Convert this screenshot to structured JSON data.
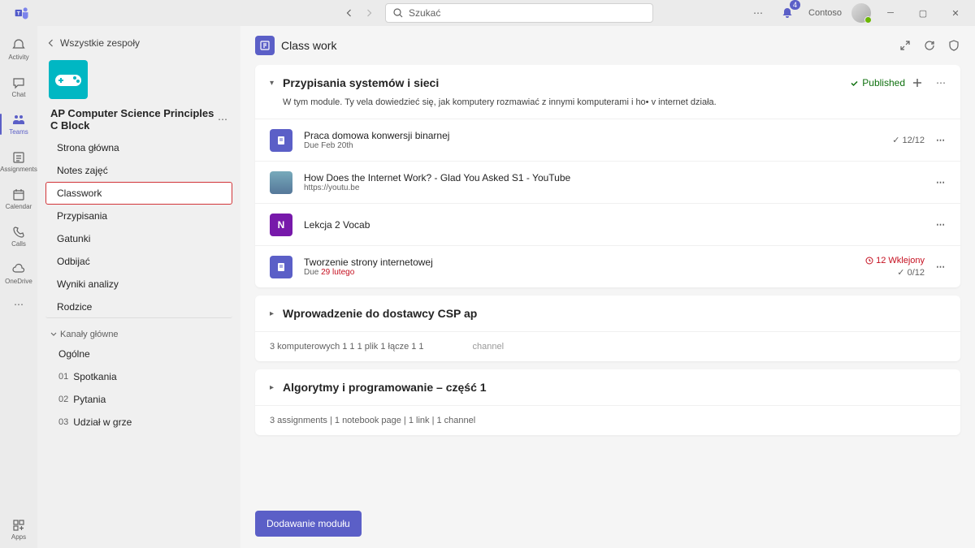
{
  "search": {
    "placeholder": "Szukać"
  },
  "header": {
    "org": "Contoso",
    "notification_count": "4"
  },
  "rail": {
    "activity": "Activity",
    "chat": "Chat",
    "teams": "Teams",
    "assignments": "Assignments",
    "calendar": "Calendar",
    "calls": "Calls",
    "onedrive": "OneDrive",
    "apps": "Apps"
  },
  "leftpane": {
    "back_label": "Wszystkie zespoły",
    "team_name": "AP Computer Science Principles C Block",
    "nav": {
      "home": "Strona główna",
      "notes": "Notes zajęć",
      "classwork": "Classwork",
      "assignments": "Przypisania",
      "grades": "Gatunki",
      "reflect": "Odbijać",
      "insights": "Wyniki analizy",
      "parents": "Rodzice"
    },
    "channels_header": "Kanały główne",
    "channels": [
      {
        "prefix": "",
        "name": "Ogólne"
      },
      {
        "prefix": "01",
        "name": "Spotkania"
      },
      {
        "prefix": "02",
        "name": "Pytania"
      },
      {
        "prefix": "03",
        "name": "Udział w grze"
      }
    ]
  },
  "main": {
    "title": "Class work",
    "add_module_btn": "Dodawanie modułu"
  },
  "modules": [
    {
      "title": "Przypisania systemów i sieci",
      "expanded": true,
      "published": "Published",
      "description": "W tym module. Ty vela dowiedzieć się, jak komputery rozmawiać z innymi komputerami i ho• v internet działa.",
      "items": [
        {
          "type": "assign",
          "title": "Praca domowa konwersji binarnej",
          "sub": "Due Feb 20th",
          "right": "12/12",
          "rcheck": true
        },
        {
          "type": "link",
          "title": "How Does the Internet Work? - Glad You Asked S1 - YouTube",
          "sub": "https://youtu.be"
        },
        {
          "type": "onenote",
          "title": "Lekcja 2 Vocab"
        },
        {
          "type": "assign",
          "title": "Tworzenie strony internetowej",
          "sub": "Due 29 lutego",
          "late": "12",
          "late_label": "Wklejony",
          "right": "0/12",
          "rcheck": true,
          "due_red": true
        }
      ]
    },
    {
      "title": "Wprowadzenie do dostawcy CSP ap",
      "expanded": false,
      "summary": "3 komputerowych 1 1 1 plik 1 łącze 1 1",
      "summary_channel": "channel"
    },
    {
      "title": "Algorytmy i programowanie – część 1",
      "expanded": false,
      "summary": "3 assignments  |  1 notebook page  |  1 link  |  1 channel"
    }
  ]
}
